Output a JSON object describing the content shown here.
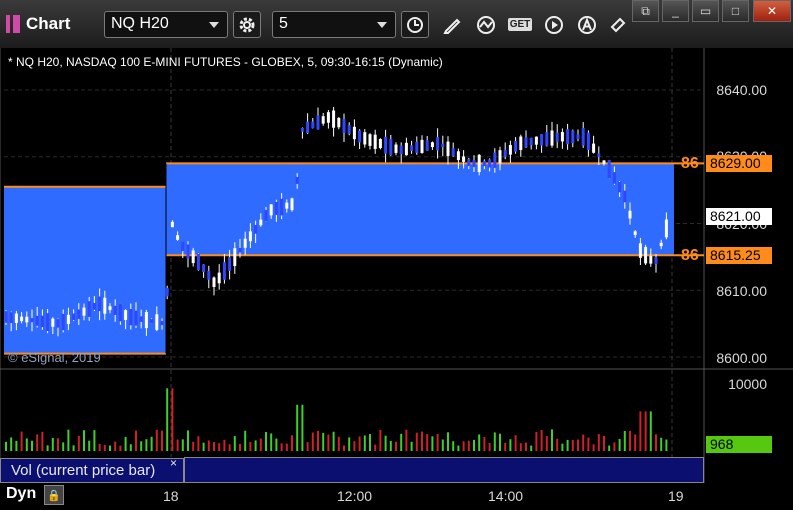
{
  "app": {
    "title": "Chart"
  },
  "toolbar": {
    "symbol": "NQ H20",
    "interval": "5",
    "get_label": "GET"
  },
  "window_buttons": [
    "restore",
    "minimize",
    "maximize",
    "close"
  ],
  "chart": {
    "symbol_line": "* NQ H20, NASDAQ 100 E-MINI FUTURES - GLOBEX, 5, 09:30-16:15 (Dynamic)",
    "price_axis_labels": [
      "8640.00",
      "8630.00",
      "8620.00",
      "8610.00",
      "8600.00"
    ],
    "price_tags": {
      "upper": "8629.00",
      "current": "8621.00",
      "lower": "8615.25",
      "upper_level_label": "86",
      "lower_level_label": "86"
    },
    "watermark": "© eSignal, 2019",
    "colors": {
      "zone": "#2f6bff",
      "level_line": "#ff8c1a",
      "up_bar": "#ffffff",
      "down_bar": "#2f48ff"
    }
  },
  "volume": {
    "axis_labels": [
      "10000",
      "0"
    ],
    "current_tag": "968",
    "study_label": "Vol (current price bar)",
    "close_glyph": "×",
    "colors": {
      "up": "#3fd12b",
      "down": "#d0202a"
    }
  },
  "time_axis": {
    "labels": [
      "18",
      "12:00",
      "14:00",
      "19"
    ]
  },
  "bottom": {
    "dyn_label": "Dyn"
  },
  "chart_data": {
    "type": "candlestick",
    "symbol": "NQ H20",
    "interval_minutes": 5,
    "y_range": [
      8598,
      8647
    ],
    "zones": [
      {
        "from": 8600.5,
        "to": 8625.5,
        "segment": "before-18"
      },
      {
        "from": 8615.25,
        "to": 8629.0,
        "segment": "after-18"
      }
    ],
    "last_price": 8621.0,
    "volume_max": 10000,
    "last_volume": 968
  }
}
